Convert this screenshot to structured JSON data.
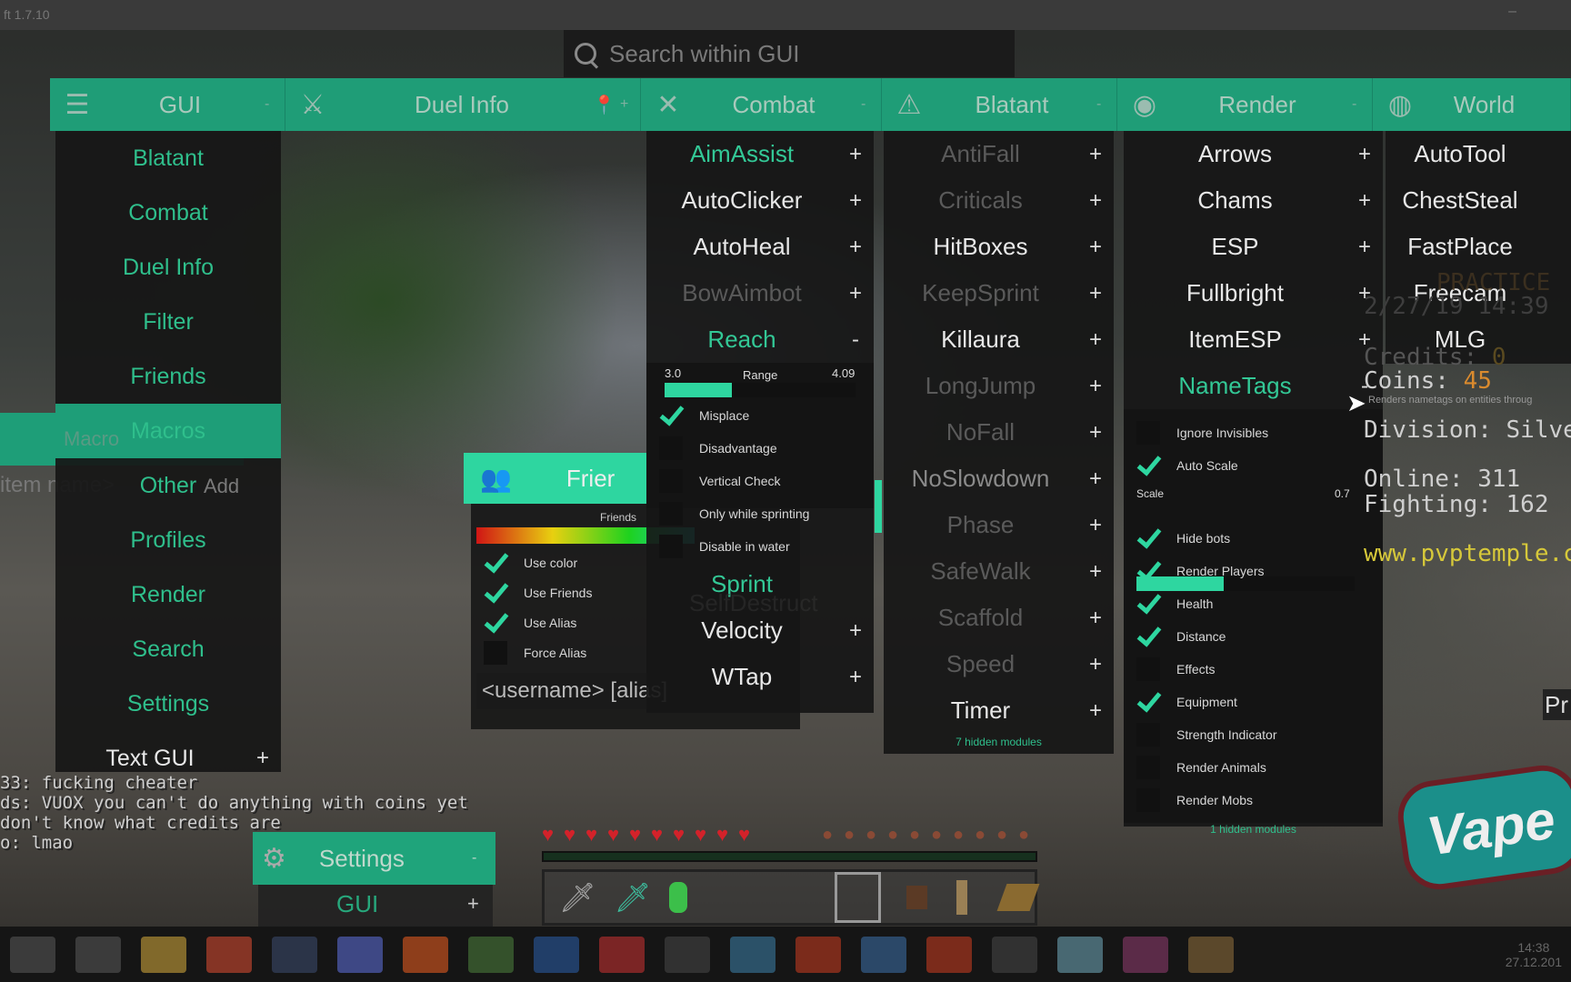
{
  "window": {
    "title": "ft 1.7.10",
    "minimize": "–"
  },
  "colors": {
    "accent": "#2ed6a0",
    "category_bar": "#1f9d77",
    "panel": "#161616"
  },
  "search": {
    "placeholder": "Search within GUI",
    "icon": "search-icon"
  },
  "categories": [
    {
      "label": "GUI",
      "icon": "menu-icon",
      "glyph": "☰",
      "toggle": "-"
    },
    {
      "label": "Duel Info",
      "icon": "sword-target-icon",
      "glyph": "⚔",
      "toggle": "+",
      "extra_icon": "map-pin-icon",
      "extra_glyph": "📍"
    },
    {
      "label": "Combat",
      "icon": "crossed-swords-icon",
      "glyph": "✕",
      "toggle": "-"
    },
    {
      "label": "Blatant",
      "icon": "warning-icon",
      "glyph": "⚠",
      "toggle": "-"
    },
    {
      "label": "Render",
      "icon": "eye-icon",
      "glyph": "◉",
      "toggle": "-"
    },
    {
      "label": "World",
      "icon": "globe-icon",
      "glyph": "◍",
      "toggle": ""
    }
  ],
  "gui_column": {
    "items": [
      {
        "label": "Blatant"
      },
      {
        "label": "Combat"
      },
      {
        "label": "Duel Info"
      },
      {
        "label": "Filter"
      },
      {
        "label": "Friends"
      },
      {
        "label": "Macros"
      },
      {
        "label": "Other"
      },
      {
        "label": "Profiles"
      },
      {
        "label": "Render"
      },
      {
        "label": "Search"
      },
      {
        "label": "Settings"
      },
      {
        "label": "Text GUI",
        "toggle": "+"
      }
    ],
    "macros_ghost": "Macro",
    "macros_toggle": "-",
    "item_name_ghost": "item name>",
    "add_ghost": "Add"
  },
  "combat": {
    "modules": [
      {
        "label": "AimAssist",
        "style": "active",
        "toggle": "+"
      },
      {
        "label": "AutoClicker",
        "style": "normal",
        "toggle": "+"
      },
      {
        "label": "AutoHeal",
        "style": "normal",
        "toggle": "+"
      },
      {
        "label": "BowAimbot",
        "style": "dim",
        "toggle": "+"
      },
      {
        "label": "Reach",
        "style": "active",
        "toggle": "-"
      }
    ],
    "reach": {
      "min": "3.0",
      "label": "Range",
      "value": "4.09",
      "fill": 0.35,
      "options": [
        {
          "label": "Misplace",
          "checked": true
        },
        {
          "label": "Disadvantage",
          "checked": false
        },
        {
          "label": "Vertical Check",
          "checked": false
        },
        {
          "label": "Only while sprinting",
          "checked": false
        },
        {
          "label": "Disable in water",
          "checked": false
        }
      ]
    },
    "modules_after": [
      {
        "label": "Sprint",
        "style": "active",
        "toggle": ""
      },
      {
        "label": "Velocity",
        "style": "normal",
        "toggle": "+"
      },
      {
        "label": "WTap",
        "style": "normal",
        "toggle": "+"
      }
    ],
    "ghost": "SelfDestruct"
  },
  "blatant": {
    "modules": [
      {
        "label": "AntiFall",
        "style": "dim",
        "toggle": "+"
      },
      {
        "label": "Criticals",
        "style": "dim",
        "toggle": "+"
      },
      {
        "label": "HitBoxes",
        "style": "normal",
        "toggle": "+"
      },
      {
        "label": "KeepSprint",
        "style": "dim",
        "toggle": "+"
      },
      {
        "label": "Killaura",
        "style": "normal",
        "toggle": "+"
      },
      {
        "label": "LongJump",
        "style": "dim",
        "toggle": "+"
      },
      {
        "label": "NoFall",
        "style": "dim",
        "toggle": "+"
      },
      {
        "label": "NoSlowdown",
        "style": "mid",
        "toggle": "+"
      },
      {
        "label": "Phase",
        "style": "dim",
        "toggle": "+"
      },
      {
        "label": "SafeWalk",
        "style": "dim",
        "toggle": "+"
      },
      {
        "label": "Scaffold",
        "style": "dim",
        "toggle": "+"
      },
      {
        "label": "Speed",
        "style": "dim",
        "toggle": "+"
      },
      {
        "label": "Timer",
        "style": "normal",
        "toggle": "+"
      }
    ],
    "hidden": "7 hidden modules"
  },
  "render": {
    "modules": [
      {
        "label": "Arrows",
        "style": "normal",
        "toggle": "+"
      },
      {
        "label": "Chams",
        "style": "normal",
        "toggle": "+"
      },
      {
        "label": "ESP",
        "style": "normal",
        "toggle": "+"
      },
      {
        "label": "Fullbright",
        "style": "normal",
        "toggle": "+"
      },
      {
        "label": "ItemESP",
        "style": "normal",
        "toggle": "+"
      },
      {
        "label": "NameTags",
        "style": "active",
        "toggle": "-"
      }
    ],
    "tooltip": "Renders nametags on entities throug",
    "nametags": {
      "options_top": [
        {
          "label": "Ignore Invisibles",
          "checked": false
        },
        {
          "label": "Auto Scale",
          "checked": true
        }
      ],
      "scale_label": "Scale",
      "scale_value": "0.7",
      "scale_fill": 0.4,
      "options": [
        {
          "label": "Hide bots",
          "checked": true
        },
        {
          "label": "Render Players",
          "checked": true
        },
        {
          "label": "Health",
          "checked": true
        },
        {
          "label": "Distance",
          "checked": true
        },
        {
          "label": "Effects",
          "checked": false
        },
        {
          "label": "Equipment",
          "checked": true
        },
        {
          "label": "Strength Indicator",
          "checked": false
        },
        {
          "label": "Render Animals",
          "checked": false
        },
        {
          "label": "Render Mobs",
          "checked": false
        }
      ]
    },
    "hidden": "1 hidden modules"
  },
  "world": {
    "modules": [
      {
        "label": "AutoTool"
      },
      {
        "label": "ChestSteal"
      },
      {
        "label": "FastPlace"
      },
      {
        "label": "Freecam"
      },
      {
        "label": "MLG"
      }
    ]
  },
  "friends": {
    "title": "Frier",
    "icon": "users-icon",
    "color_label": "Friends",
    "options": [
      {
        "label": "Use color",
        "checked": true
      },
      {
        "label": "Use Friends",
        "checked": true
      },
      {
        "label": "Use Alias",
        "checked": true
      },
      {
        "label": "Force Alias",
        "checked": false
      }
    ],
    "input_placeholder": "<username> [alias]",
    "add": "Add"
  },
  "settings_panel": {
    "title": "Settings",
    "icon": "gears-icon",
    "toggle": "-",
    "item": "GUI",
    "item_toggle": "+"
  },
  "scoreboard": {
    "title": "PRACTICE",
    "date": "2/27/19 14:39",
    "credits_label": "Credits:",
    "credits": "0",
    "coins_label": "Coins:",
    "coins": "45",
    "division": "Division: Silver I",
    "online": "Online: 311",
    "fighting": "Fighting: 162",
    "site": "www.pvptemple.c",
    "side_label": "Pr"
  },
  "chat": [
    "33: fucking cheater",
    "ds: VUOX you can't do anything with coins yet",
    "don't know what credits are",
    "o: lmao"
  ],
  "hud": {
    "hearts": 10,
    "hunger": 10,
    "hotbar": [
      "iron-sword",
      "diamond-sword",
      "emerald",
      "",
      "selected-empty",
      "steve-head",
      "sign",
      "book"
    ]
  },
  "logo_text": "Vape",
  "taskbar": {
    "apps": [
      "search",
      "task-view",
      "file-explorer",
      "chrome",
      "steam-headset",
      "discord",
      "origin",
      "minecraft",
      "vegas",
      "anydesk",
      "terminal",
      "l1",
      "origin-2",
      "nordvpn",
      "recorder",
      "obs",
      "notepad",
      "winrar",
      "minecraft-2"
    ],
    "time": "14:38",
    "date": "27.12.201"
  }
}
